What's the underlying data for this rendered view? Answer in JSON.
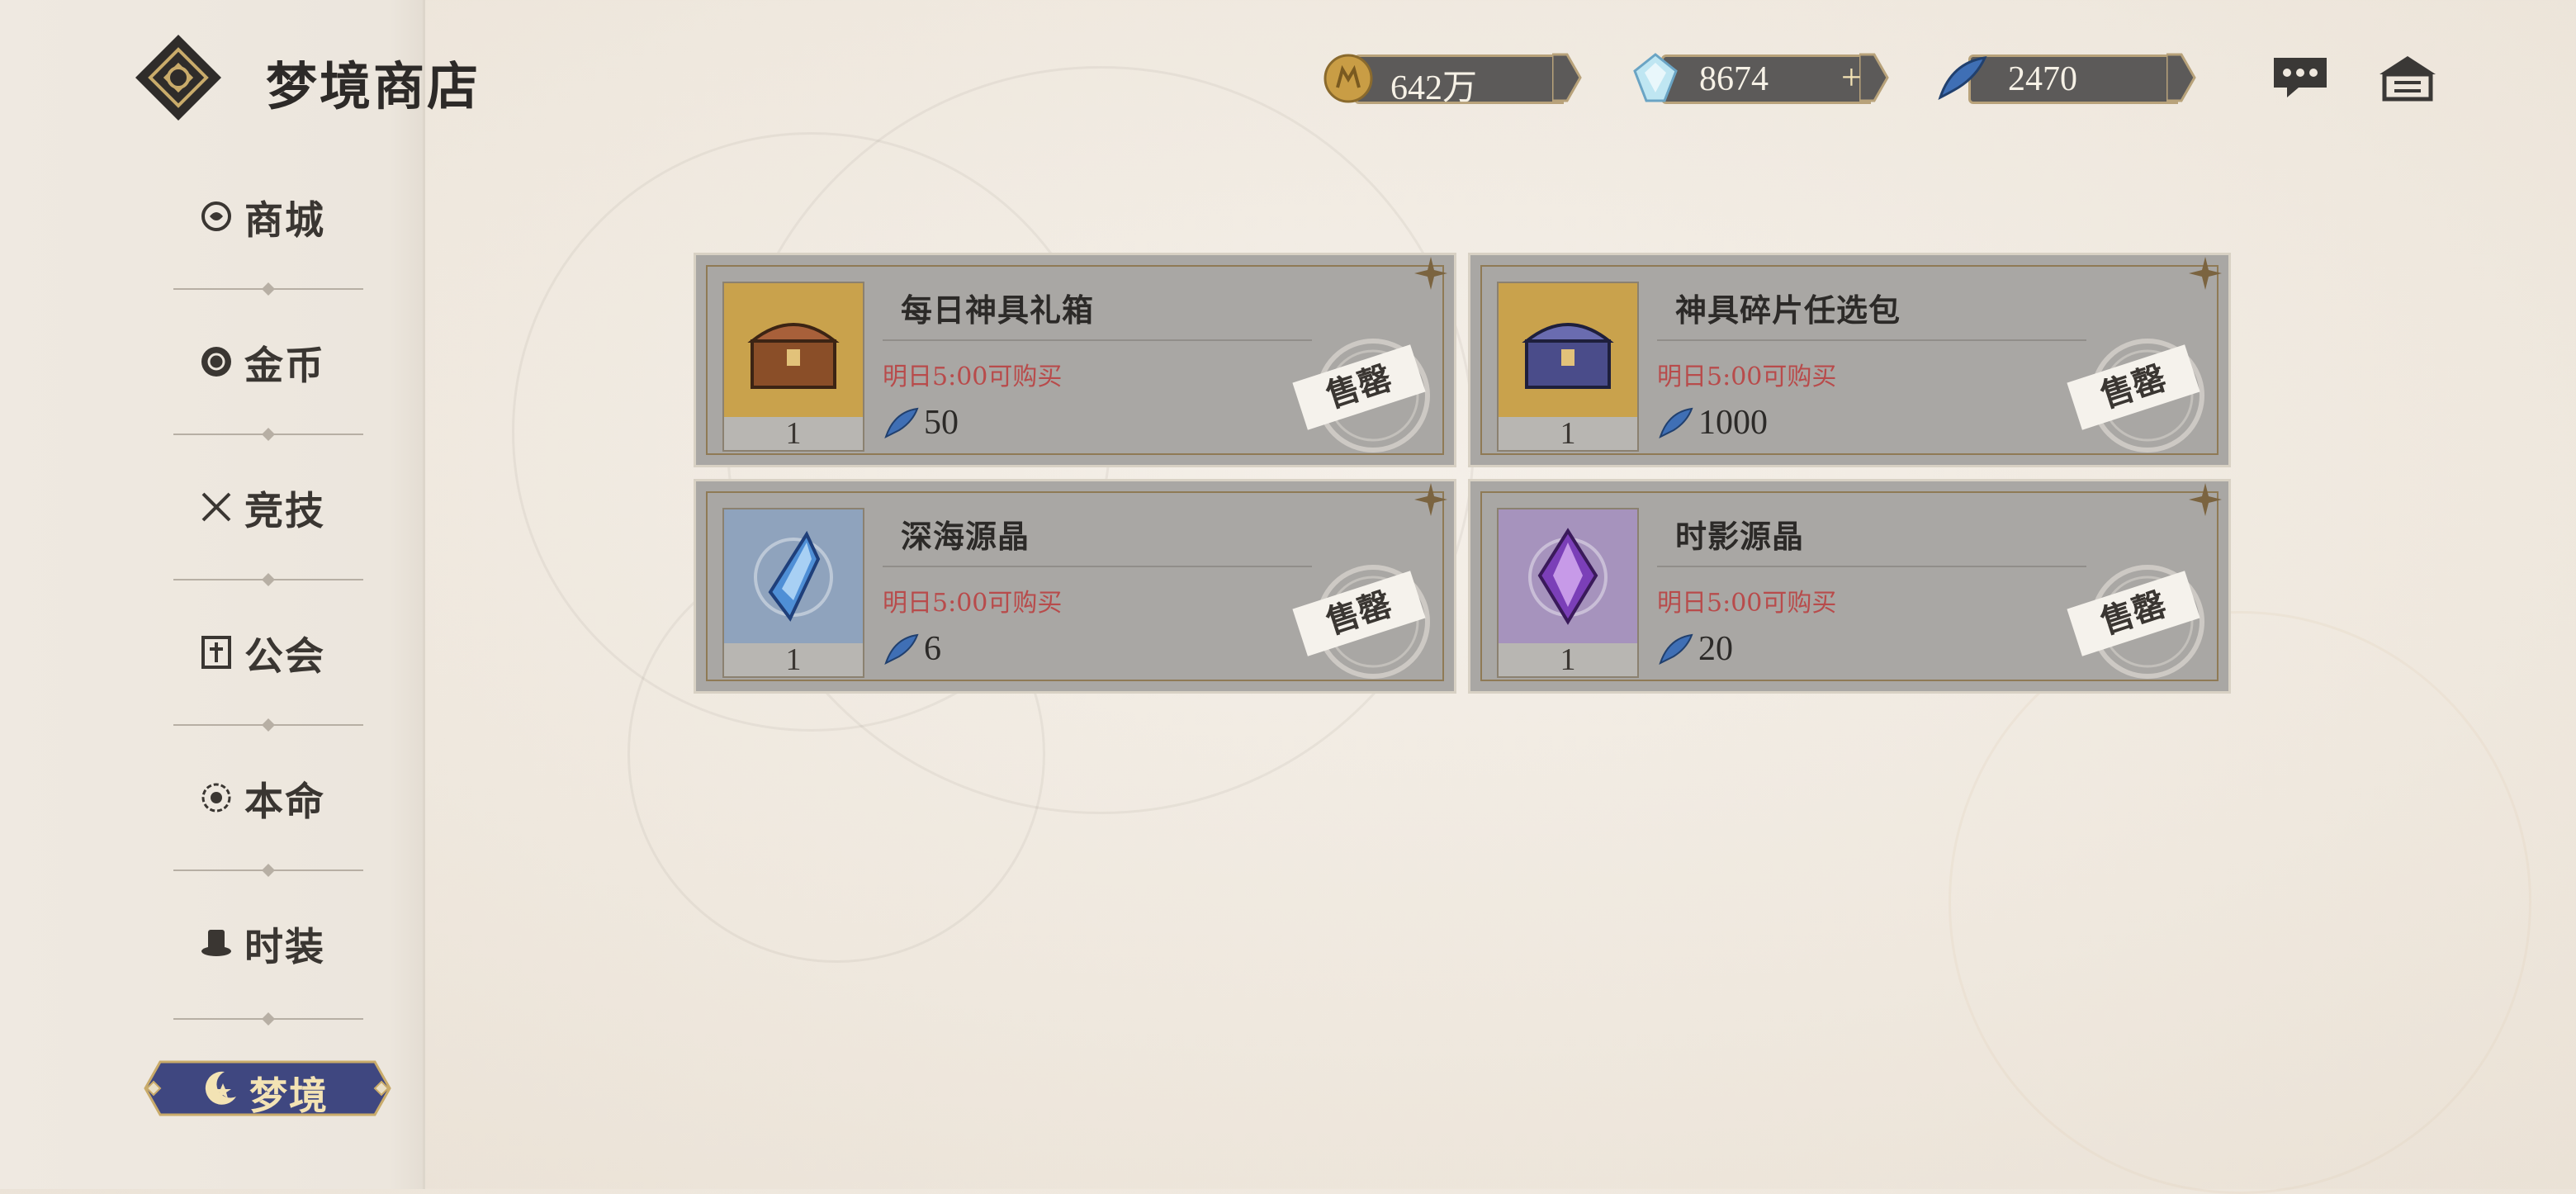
{
  "header": {
    "title": "梦境商店"
  },
  "currencies": [
    {
      "icon": "gold-coin-icon",
      "value": "642万"
    },
    {
      "icon": "diamond-icon",
      "value": "8674",
      "add": "+"
    },
    {
      "icon": "blue-feather-icon",
      "value": "2470"
    }
  ],
  "top_icons": [
    "chat-icon",
    "home-icon"
  ],
  "sidebar": {
    "items": [
      {
        "label": "商城",
        "icon": "mall-icon"
      },
      {
        "label": "金币",
        "icon": "coin-icon"
      },
      {
        "label": "竞技",
        "icon": "crossed-swords-icon"
      },
      {
        "label": "公会",
        "icon": "guild-icon"
      },
      {
        "label": "本命",
        "icon": "destiny-icon"
      },
      {
        "label": "时装",
        "icon": "top-hat-icon"
      },
      {
        "label": "梦境",
        "icon": "moon-star-icon",
        "active": true
      }
    ]
  },
  "products": [
    {
      "name": "每日神具礼箱",
      "qty": "1",
      "timer": "明日5:00可购买",
      "price": "50",
      "sold_label": "售罄",
      "thumb_color": "#c9a24c"
    },
    {
      "name": "神具碎片任选包",
      "qty": "1",
      "timer": "明日5:00可购买",
      "price": "1000",
      "sold_label": "售罄",
      "thumb_color": "#c9a24c"
    },
    {
      "name": "深海源晶",
      "qty": "1",
      "timer": "明日5:00可购买",
      "price": "6",
      "sold_label": "售罄",
      "thumb_color": "#8fa3bd"
    },
    {
      "name": "时影源晶",
      "qty": "1",
      "timer": "明日5:00可购买",
      "price": "20",
      "sold_label": "售罄",
      "thumb_color": "#a693bd"
    }
  ]
}
